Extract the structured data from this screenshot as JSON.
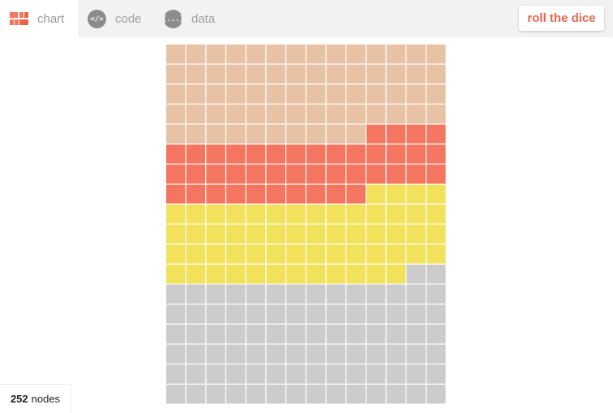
{
  "tabs": [
    {
      "label": "chart",
      "icon": "waffle-chart-icon"
    },
    {
      "label": "code",
      "icon": "code-icon"
    },
    {
      "label": "data",
      "icon": "data-braces-icon"
    }
  ],
  "code_icon_glyph": "</>",
  "data_icon_glyph": "{...}",
  "roll_button": "roll the dice",
  "node_count": "252",
  "node_label": "nodes",
  "colors": {
    "accent": "#e8654a",
    "topbar": "#f2f2f2",
    "tab_icon": "#8c8c8c"
  },
  "chart_data": {
    "type": "waffle",
    "columns": 14,
    "rows": 18,
    "fill_order": "row-major, top to bottom",
    "total": 252,
    "series": [
      {
        "count": 66,
        "color": "#e8c2a4"
      },
      {
        "count": 42,
        "color": "#f47560"
      },
      {
        "count": 58,
        "color": "#f1e15b"
      },
      {
        "count": 86,
        "color": "#cccccc"
      }
    ]
  }
}
